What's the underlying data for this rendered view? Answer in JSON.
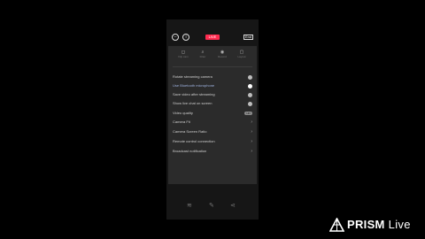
{
  "topbar": {
    "left_icon_1": "minimize-icon",
    "left_icon_2": "info-icon",
    "live_label": "LIVE",
    "end_label": "End"
  },
  "tools": [
    {
      "icon": "camera-icon",
      "label": "Flip cam"
    },
    {
      "icon": "filter-icon",
      "label": "Filter"
    },
    {
      "icon": "record-icon",
      "label": "Record"
    },
    {
      "icon": "layout-icon",
      "label": "Layout"
    }
  ],
  "settings": [
    {
      "label": "Rotate streaming camera",
      "control": "toggle"
    },
    {
      "label": "Use Bluetooth microphone",
      "control": "toggle",
      "on": true,
      "blue": true
    },
    {
      "label": "Save video after streaming",
      "control": "toggle"
    },
    {
      "label": "Show live chat on screen",
      "control": "toggle"
    },
    {
      "label": "Video quality",
      "control": "hd",
      "value": "HD"
    },
    {
      "label": "Camera Fit",
      "control": "chevron"
    },
    {
      "label": "Camera Screen Ratio",
      "control": "chevron"
    },
    {
      "label": "Remote control connection",
      "control": "chevron"
    },
    {
      "label": "Broadcast notification",
      "control": "chevron"
    }
  ],
  "bottombar": [
    "layers-icon",
    "pen-icon",
    "share-icon"
  ],
  "brand": {
    "name": "PRISM",
    "suffix": "Live"
  },
  "colors": {
    "accent": "#ff2b4f",
    "panel": "#2b2b2b",
    "background": "#000000"
  }
}
